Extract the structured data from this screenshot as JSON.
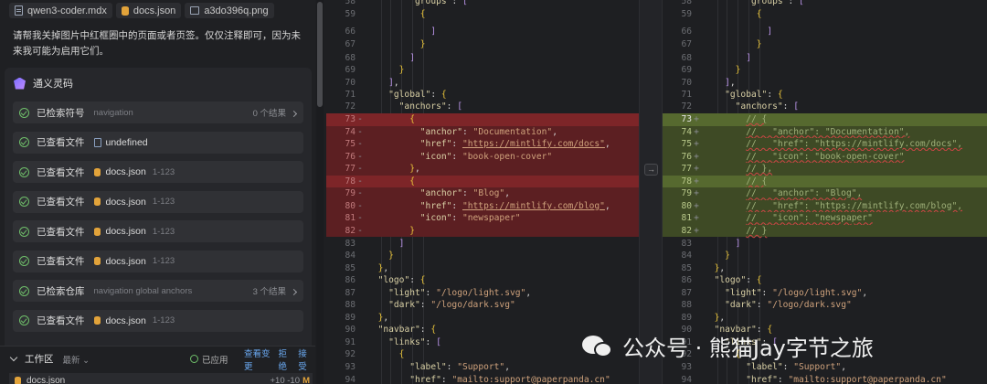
{
  "context_chips": [
    {
      "icon": "file-icon",
      "label": "qwen3-coder.mdx"
    },
    {
      "icon": "database-icon",
      "label": "docs.json"
    },
    {
      "icon": "image-icon",
      "label": "a3do396q.png"
    }
  ],
  "user_message": "请帮我关掉图片中红框圈中的页面或者页签。仅仅注释即可，因为未来我可能为启用它们。",
  "assistant": {
    "name": "通义灵码",
    "steps": [
      {
        "action": "已检索符号",
        "target": "navigation",
        "range": "",
        "result": "0 个结果",
        "icon": "none"
      },
      {
        "action": "已查看文件",
        "target": "undefined",
        "range": "",
        "result": "",
        "icon": "file-icon"
      },
      {
        "action": "已查看文件",
        "target": "docs.json",
        "range": "1-123",
        "result": "",
        "icon": "database-icon"
      },
      {
        "action": "已查看文件",
        "target": "docs.json",
        "range": "1-123",
        "result": "",
        "icon": "database-icon"
      },
      {
        "action": "已查看文件",
        "target": "docs.json",
        "range": "1-123",
        "result": "",
        "icon": "database-icon"
      },
      {
        "action": "已查看文件",
        "target": "docs.json",
        "range": "1-123",
        "result": "",
        "icon": "database-icon"
      },
      {
        "action": "已检索仓库",
        "target": "navigation global anchors",
        "range": "",
        "result": "3 个结果",
        "icon": "none"
      },
      {
        "action": "已查看文件",
        "target": "docs.json",
        "range": "1-123",
        "result": "",
        "icon": "database-icon"
      }
    ]
  },
  "workspace": {
    "title": "工作区",
    "filter": "最新",
    "applied": "已应用",
    "actions": [
      "查看变更",
      "拒绝",
      "接受"
    ],
    "file": {
      "name": "docs.json",
      "stats": "+10 -10",
      "status": "M"
    }
  },
  "diff": {
    "left": [
      {
        "n": "58",
        "m": "",
        "t": "        \"groups\": [",
        "cls": ""
      },
      {
        "n": "59",
        "m": "",
        "t": "          {",
        "cls": ""
      },
      {
        "n": "66",
        "m": "",
        "t": "            ]",
        "cls": ""
      },
      {
        "n": "67",
        "m": "",
        "t": "          }",
        "cls": ""
      },
      {
        "n": "68",
        "m": "",
        "t": "        ]",
        "cls": ""
      },
      {
        "n": "69",
        "m": "",
        "t": "      }",
        "cls": ""
      },
      {
        "n": "70",
        "m": "",
        "t": "    ],",
        "cls": ""
      },
      {
        "n": "71",
        "m": "",
        "t": "    \"global\": {",
        "cls": ""
      },
      {
        "n": "72",
        "m": "",
        "t": "      \"anchors\": [",
        "cls": ""
      },
      {
        "n": "73",
        "m": "-",
        "t": "        {",
        "cls": "del-strong"
      },
      {
        "n": "74",
        "m": "-",
        "t": "          \"anchor\": \"Documentation\",",
        "cls": "del"
      },
      {
        "n": "75",
        "m": "-",
        "t": "          \"href\": \"https://mintlify.com/docs\",",
        "cls": "del"
      },
      {
        "n": "76",
        "m": "-",
        "t": "          \"icon\": \"book-open-cover\"",
        "cls": "del"
      },
      {
        "n": "77",
        "m": "-",
        "t": "        },",
        "cls": "del"
      },
      {
        "n": "78",
        "m": "-",
        "t": "        {",
        "cls": "del-strong"
      },
      {
        "n": "79",
        "m": "-",
        "t": "          \"anchor\": \"Blog\",",
        "cls": "del"
      },
      {
        "n": "80",
        "m": "-",
        "t": "          \"href\": \"https://mintlify.com/blog\",",
        "cls": "del"
      },
      {
        "n": "81",
        "m": "-",
        "t": "          \"icon\": \"newspaper\"",
        "cls": "del"
      },
      {
        "n": "82",
        "m": "-",
        "t": "        }",
        "cls": "del"
      },
      {
        "n": "83",
        "m": "",
        "t": "      ]",
        "cls": ""
      },
      {
        "n": "84",
        "m": "",
        "t": "    }",
        "cls": ""
      },
      {
        "n": "85",
        "m": "",
        "t": "  },",
        "cls": ""
      },
      {
        "n": "86",
        "m": "",
        "t": "  \"logo\": {",
        "cls": ""
      },
      {
        "n": "87",
        "m": "",
        "t": "    \"light\": \"/logo/light.svg\",",
        "cls": ""
      },
      {
        "n": "88",
        "m": "",
        "t": "    \"dark\": \"/logo/dark.svg\"",
        "cls": ""
      },
      {
        "n": "89",
        "m": "",
        "t": "  },",
        "cls": ""
      },
      {
        "n": "90",
        "m": "",
        "t": "  \"navbar\": {",
        "cls": ""
      },
      {
        "n": "91",
        "m": "",
        "t": "    \"links\": [",
        "cls": ""
      },
      {
        "n": "92",
        "m": "",
        "t": "      {",
        "cls": ""
      },
      {
        "n": "93",
        "m": "",
        "t": "        \"label\": \"Support\",",
        "cls": ""
      },
      {
        "n": "94",
        "m": "",
        "t": "        \"href\": \"mailto:support@paperpanda.cn\"",
        "cls": ""
      }
    ],
    "right": [
      {
        "n": "58",
        "m": "",
        "t": "        \"groups\": [",
        "cls": ""
      },
      {
        "n": "59",
        "m": "",
        "t": "          {",
        "cls": ""
      },
      {
        "n": "66",
        "m": "",
        "t": "            ]",
        "cls": ""
      },
      {
        "n": "67",
        "m": "",
        "t": "          }",
        "cls": ""
      },
      {
        "n": "68",
        "m": "",
        "t": "        ]",
        "cls": ""
      },
      {
        "n": "69",
        "m": "",
        "t": "      }",
        "cls": ""
      },
      {
        "n": "70",
        "m": "",
        "t": "    ],",
        "cls": ""
      },
      {
        "n": "71",
        "m": "",
        "t": "    \"global\": {",
        "cls": ""
      },
      {
        "n": "72",
        "m": "",
        "t": "      \"anchors\": [",
        "cls": ""
      },
      {
        "n": "73",
        "m": "+",
        "t": "        // {",
        "cls": "add-strong cur"
      },
      {
        "n": "74",
        "m": "+",
        "t": "        //   \"anchor\": \"Documentation\",",
        "cls": "add"
      },
      {
        "n": "75",
        "m": "+",
        "t": "        //   \"href\": \"https://mintlify.com/docs\",",
        "cls": "add"
      },
      {
        "n": "76",
        "m": "+",
        "t": "        //   \"icon\": \"book-open-cover\"",
        "cls": "add"
      },
      {
        "n": "77",
        "m": "+",
        "t": "        // },",
        "cls": "add"
      },
      {
        "n": "78",
        "m": "+",
        "t": "        // {",
        "cls": "add-strong"
      },
      {
        "n": "79",
        "m": "+",
        "t": "        //   \"anchor\": \"Blog\",",
        "cls": "add"
      },
      {
        "n": "80",
        "m": "+",
        "t": "        //   \"href\": \"https://mintlify.com/blog\",",
        "cls": "add"
      },
      {
        "n": "81",
        "m": "+",
        "t": "        //   \"icon\": \"newspaper\"",
        "cls": "add"
      },
      {
        "n": "82",
        "m": "+",
        "t": "        // }",
        "cls": "add"
      },
      {
        "n": "83",
        "m": "",
        "t": "      ]",
        "cls": ""
      },
      {
        "n": "84",
        "m": "",
        "t": "    }",
        "cls": ""
      },
      {
        "n": "85",
        "m": "",
        "t": "  },",
        "cls": ""
      },
      {
        "n": "86",
        "m": "",
        "t": "  \"logo\": {",
        "cls": ""
      },
      {
        "n": "87",
        "m": "",
        "t": "    \"light\": \"/logo/light.svg\",",
        "cls": ""
      },
      {
        "n": "88",
        "m": "",
        "t": "    \"dark\": \"/logo/dark.svg\"",
        "cls": ""
      },
      {
        "n": "89",
        "m": "",
        "t": "  },",
        "cls": ""
      },
      {
        "n": "90",
        "m": "",
        "t": "  \"navbar\": {",
        "cls": ""
      },
      {
        "n": "91",
        "m": "",
        "t": "    \"links\": [",
        "cls": ""
      },
      {
        "n": "92",
        "m": "",
        "t": "      {",
        "cls": ""
      },
      {
        "n": "93",
        "m": "",
        "t": "        \"label\": \"Support\",",
        "cls": ""
      },
      {
        "n": "94",
        "m": "",
        "t": "        \"href\": \"mailto:support@paperpanda.cn\"",
        "cls": ""
      }
    ]
  },
  "watermark": "公众号 · 熊猫Jay字节之旅",
  "colors": {
    "deleted": "#7d2528",
    "added": "#56692f",
    "accent_link": "#6aa8f0",
    "ok_green": "#6fbf6a"
  }
}
